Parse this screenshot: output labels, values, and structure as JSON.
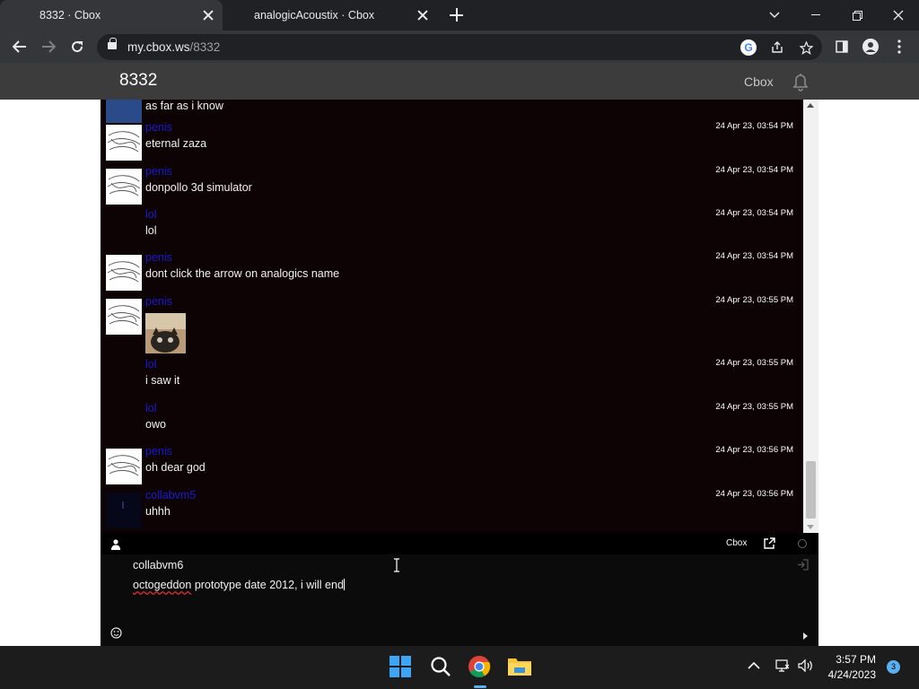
{
  "browser": {
    "tabs": [
      {
        "title": "8332 · Cbox",
        "active": true
      },
      {
        "title": "analogicAcoustix · Cbox",
        "active": false
      }
    ],
    "url_host": "my.cbox.ws",
    "url_path": "/8332"
  },
  "site": {
    "title": "8332",
    "brand": "Cbox"
  },
  "messages": [
    {
      "name": "",
      "text": "as far as i know",
      "time": "",
      "avatar": "photo"
    },
    {
      "name": "penis",
      "text": "eternal zaza",
      "time": "24 Apr 23, 03:54 PM",
      "avatar": "sketch"
    },
    {
      "name": "penis",
      "text": "donpollo 3d simulator",
      "time": "24 Apr 23, 03:54 PM",
      "avatar": "sketch"
    },
    {
      "name": "lol",
      "text": "lol",
      "time": "24 Apr 23, 03:54 PM",
      "avatar": "none"
    },
    {
      "name": "penis",
      "text": "dont click the arrow on analogics name",
      "time": "24 Apr 23, 03:54 PM",
      "avatar": "sketch"
    },
    {
      "name": "penis",
      "text": "",
      "time": "24 Apr 23, 03:55 PM",
      "avatar": "sketch",
      "image": "cat-photo"
    },
    {
      "name": "lol",
      "text": "i saw it",
      "time": "24 Apr 23, 03:55 PM",
      "avatar": "none"
    },
    {
      "name": "lol",
      "text": "owo",
      "time": "24 Apr 23, 03:55 PM",
      "avatar": "none"
    },
    {
      "name": "penis",
      "text": "oh dear god",
      "time": "24 Apr 23, 03:56 PM",
      "avatar": "sketch"
    },
    {
      "name": "collabvm5",
      "text": "uhhh",
      "time": "24 Apr 23, 03:56 PM",
      "avatar": "dark"
    }
  ],
  "chatbar": {
    "brand": "Cbox"
  },
  "compose": {
    "name": "collabvm6",
    "text_misspelled": "octogeddon",
    "text_rest": " prototype date 2012, i will end"
  },
  "taskbar": {
    "time": "3:57 PM",
    "date": "4/24/2023",
    "notifications": "3"
  },
  "colors": {
    "username": "#1a1ad0",
    "chat_bg": "#0d0305",
    "header_bg": "#3c3c3c"
  }
}
